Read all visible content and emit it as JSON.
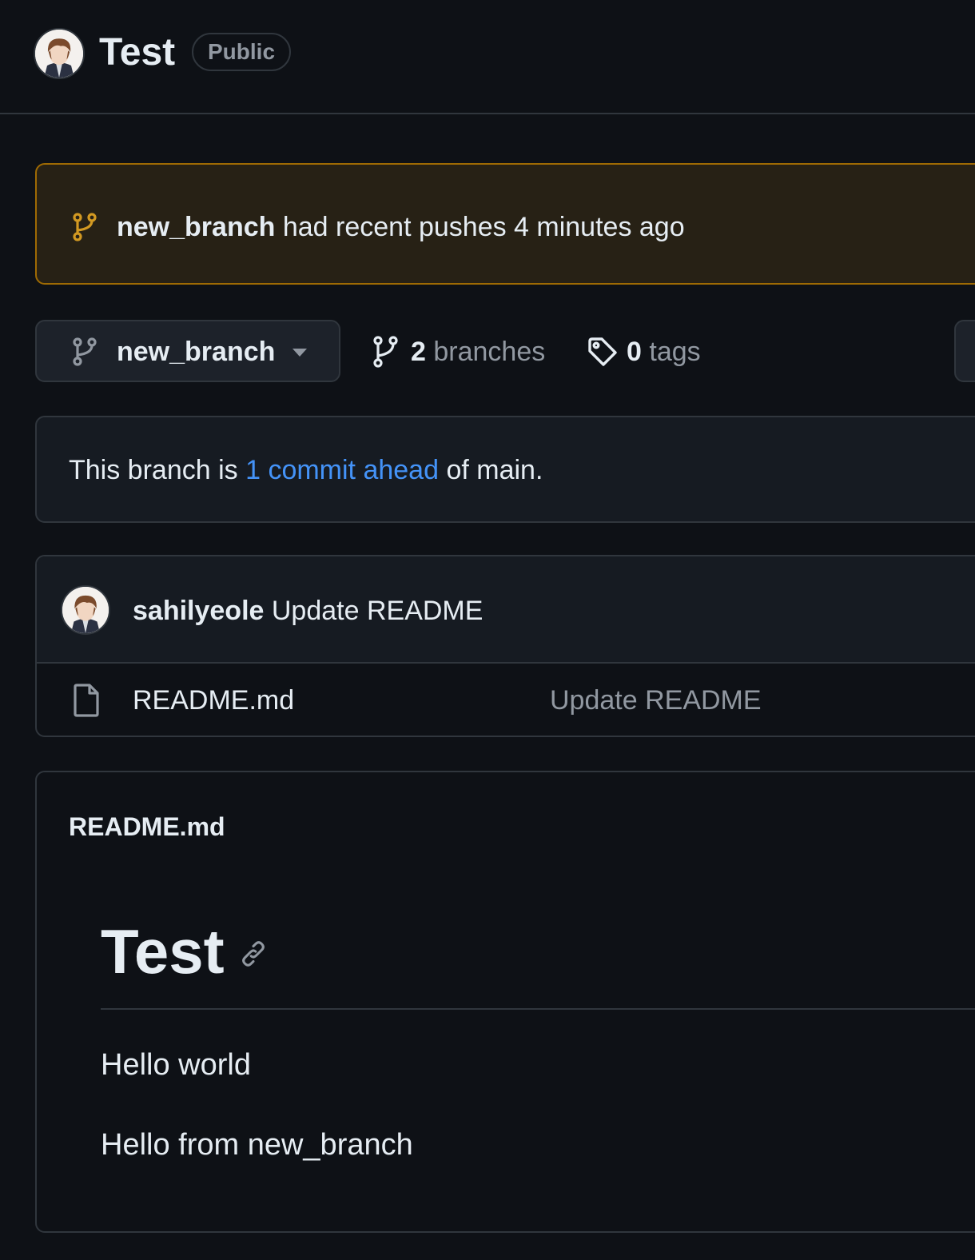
{
  "repo": {
    "name": "Test",
    "visibility": "Public"
  },
  "push_banner": {
    "branch": "new_branch",
    "message": "had recent pushes 4 minutes ago",
    "icon": "git-branch-icon"
  },
  "branch_bar": {
    "current_branch": "new_branch",
    "branches_count": "2",
    "branches_label": "branches",
    "tags_count": "0",
    "tags_label": "tags"
  },
  "ahead_notice": {
    "prefix": "This branch is",
    "link_text": "1 commit ahead",
    "suffix": "of main."
  },
  "latest_commit": {
    "author": "sahilyeole",
    "message": "Update README"
  },
  "files": [
    {
      "name": "README.md",
      "last_commit_message": "Update README",
      "icon": "file-icon"
    }
  ],
  "readme": {
    "file_title": "README.md",
    "heading": "Test",
    "paragraphs": [
      "Hello world",
      "Hello from new_branch"
    ]
  },
  "colors": {
    "background": "#0e1116",
    "banner_bg": "#272115",
    "banner_border": "#9e6a03",
    "branch_icon_attention": "#d29922",
    "link": "#4493f8",
    "muted_text": "#9198a1",
    "border": "#30363d"
  }
}
